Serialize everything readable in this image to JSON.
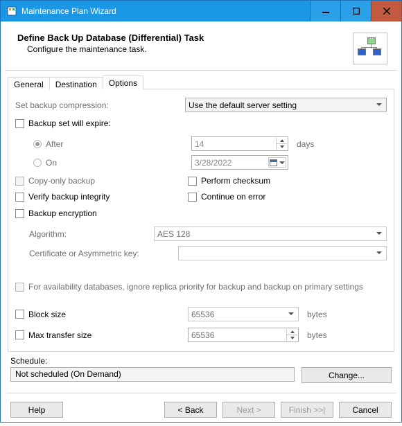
{
  "window": {
    "title": "Maintenance Plan Wizard"
  },
  "header": {
    "title": "Define Back Up Database (Differential) Task",
    "subtitle": "Configure the maintenance task."
  },
  "tabs": {
    "general": "General",
    "destination": "Destination",
    "options": "Options"
  },
  "options": {
    "compression_label": "Set backup compression:",
    "compression_value": "Use the default server setting",
    "expire_label": "Backup set will expire:",
    "after_label": "After",
    "after_value": "14",
    "after_unit": "days",
    "on_label": "On",
    "on_value": "3/28/2022",
    "copy_only_label": "Copy-only backup",
    "perform_checksum_label": "Perform checksum",
    "verify_integrity_label": "Verify backup integrity",
    "continue_on_error_label": "Continue on error",
    "encryption_label": "Backup encryption",
    "algorithm_label": "Algorithm:",
    "algorithm_value": "AES 128",
    "cert_label": "Certificate or Asymmetric key:",
    "ag_label": "For availability databases, ignore replica priority for backup and backup on primary settings",
    "block_size_label": "Block size",
    "block_size_value": "65536",
    "block_size_unit": "bytes",
    "max_transfer_label": "Max transfer size",
    "max_transfer_value": "65536",
    "max_transfer_unit": "bytes"
  },
  "schedule": {
    "label": "Schedule:",
    "value": "Not scheduled (On Demand)",
    "change": "Change..."
  },
  "footer": {
    "help": "Help",
    "back": "< Back",
    "next": "Next >",
    "finish": "Finish >>|",
    "cancel": "Cancel"
  }
}
